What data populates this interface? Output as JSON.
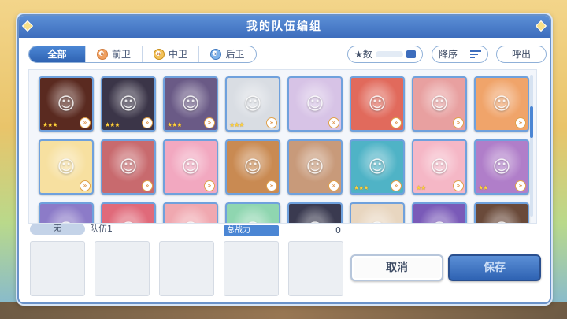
{
  "dialog": {
    "title": "我的队伍编组"
  },
  "filters": {
    "tabs": [
      {
        "label": "全部",
        "icon": "none",
        "active": true
      },
      {
        "label": "前卫",
        "icon": "front-role-icon",
        "active": false
      },
      {
        "label": "中卫",
        "icon": "mid-role-icon",
        "active": false
      },
      {
        "label": "后卫",
        "icon": "back-role-icon",
        "active": false
      }
    ],
    "sort_label": "★数",
    "order_label": "降序",
    "call_label": "呼出"
  },
  "characters": [
    {
      "stars": 3,
      "color": "#5a2a20"
    },
    {
      "stars": 3,
      "color": "#3b3548"
    },
    {
      "stars": 3,
      "color": "#6a5a86"
    },
    {
      "stars": 3,
      "color": "#d9dde3"
    },
    {
      "stars": 0,
      "color": "#d7c3e6"
    },
    {
      "stars": 0,
      "color": "#e16a5c"
    },
    {
      "stars": 0,
      "color": "#e8a0a0"
    },
    {
      "stars": 0,
      "color": "#f0a46a"
    },
    {
      "stars": 0,
      "color": "#f7e0a0"
    },
    {
      "stars": 0,
      "color": "#c86a6e"
    },
    {
      "stars": 0,
      "color": "#f2a8c0"
    },
    {
      "stars": 0,
      "color": "#c98a52"
    },
    {
      "stars": 0,
      "color": "#c89a7a"
    },
    {
      "stars": 3,
      "color": "#4fb3c6"
    },
    {
      "stars": 2,
      "color": "#f5b7c6"
    },
    {
      "stars": 2,
      "color": "#b07ec9"
    },
    {
      "stars": 0,
      "color": "#8c7bc8"
    },
    {
      "stars": 0,
      "color": "#e06a7a"
    },
    {
      "stars": 0,
      "color": "#f0a8b0"
    },
    {
      "stars": 0,
      "color": "#8fd6b0"
    },
    {
      "stars": 0,
      "color": "#3a3a50"
    },
    {
      "stars": 0,
      "color": "#e8d6c0"
    },
    {
      "stars": 0,
      "color": "#7a5ab8"
    },
    {
      "stars": 0,
      "color": "#6a4a3a"
    }
  ],
  "team": {
    "tag": "无",
    "name": "队伍1",
    "power_label": "总战力",
    "power_value": "0"
  },
  "buttons": {
    "cancel": "取消",
    "save": "保存"
  }
}
